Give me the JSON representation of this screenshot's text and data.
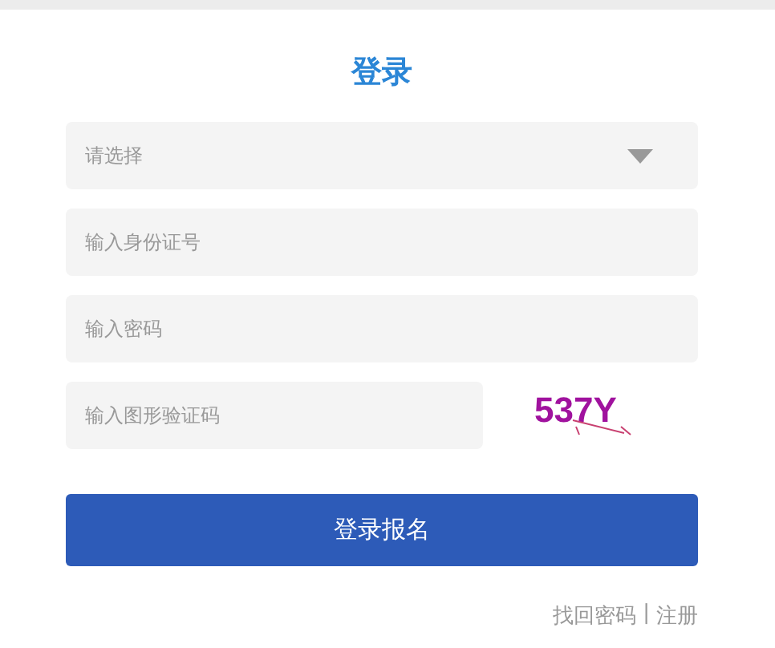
{
  "title": "登录",
  "select": {
    "placeholder": "请选择"
  },
  "id_field": {
    "placeholder": "输入身份证号"
  },
  "password_field": {
    "placeholder": "输入密码"
  },
  "captcha_field": {
    "placeholder": "输入图形验证码"
  },
  "captcha_image": {
    "text": "537Y"
  },
  "submit_button": "登录报名",
  "links": [
    {
      "label": "找回密码"
    },
    {
      "label": "注册"
    }
  ],
  "link_separator": "|"
}
